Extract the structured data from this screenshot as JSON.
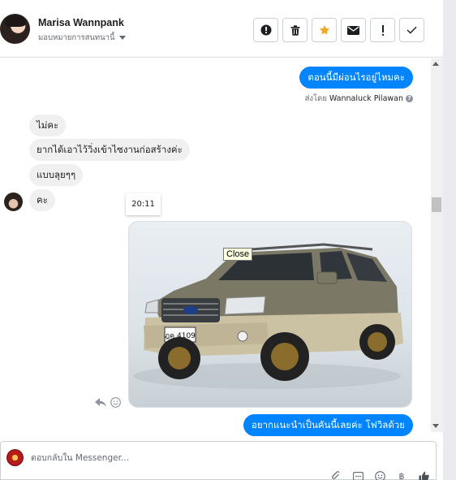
{
  "header": {
    "user_name": "Marisa Wannpank",
    "assign_label": "มอบหมายการสนทนานี้",
    "actions": [
      {
        "name": "report-icon",
        "glyph": "!"
      },
      {
        "name": "trash-icon",
        "glyph": ""
      },
      {
        "name": "star-icon",
        "glyph": "★"
      },
      {
        "name": "mail-icon",
        "glyph": ""
      },
      {
        "name": "important-icon",
        "glyph": "!"
      },
      {
        "name": "check-icon",
        "glyph": "✓"
      }
    ]
  },
  "messages": {
    "outgoing_top": "ตอนนี้มีผ่อนไรอยู่ไหมคะ",
    "sent_by_label": "ส่งโดย",
    "sent_by_name": "Wannaluck Pilawan",
    "incoming": [
      "ไม่คะ",
      "ยากได้เอาไว้วิ่งเข้าไซงานก่อสร้างค่ะ",
      "แบบลุยๆๆ",
      "คะ"
    ],
    "timestamp": "20:11",
    "photo_tooltip": "Close",
    "outgoing_bottom": "อยากแนะนำเป็นคันนี้เลยค่ะ โฟวิลด้วย",
    "plate_text": "ฎค 4109"
  },
  "composer": {
    "placeholder": "ตอบกลับใน Messenger..."
  },
  "colors": {
    "accent": "#0084ff",
    "star": "#f5a623",
    "incoming_bubble": "#f1f0f0"
  }
}
